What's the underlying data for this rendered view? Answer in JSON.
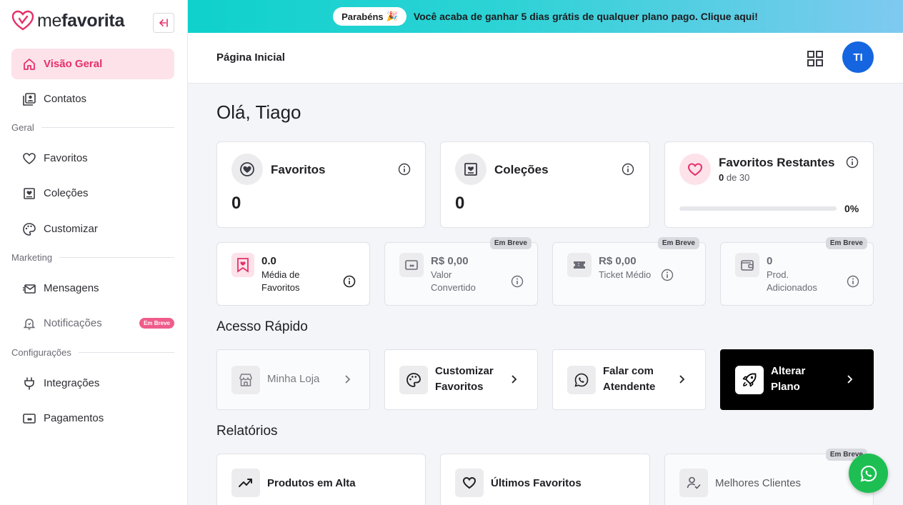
{
  "brand": {
    "name_light": "me",
    "name_bold": "favorita",
    "accent": "#e5306a"
  },
  "promo": {
    "pill": "Parabéns",
    "pill_emoji": "🎉",
    "text": "Você acaba de ganhar 5 dias grátis de qualquer plano pago. Clique aqui!"
  },
  "header": {
    "title": "Página Inicial",
    "avatar_initials": "TI"
  },
  "sidebar": {
    "items": [
      {
        "label": "Visão Geral",
        "icon": "home-icon"
      },
      {
        "label": "Contatos",
        "icon": "contacts-icon"
      },
      {
        "label": "Favoritos",
        "icon": "heart-icon"
      },
      {
        "label": "Coleções",
        "icon": "collection-icon"
      },
      {
        "label": "Customizar",
        "icon": "palette-icon"
      },
      {
        "label": "Mensagens",
        "icon": "mail-icon"
      },
      {
        "label": "Notificações",
        "icon": "bell-icon",
        "badge": "Em Breve"
      },
      {
        "label": "Integrações",
        "icon": "plug-icon"
      },
      {
        "label": "Pagamentos",
        "icon": "payment-icon"
      }
    ],
    "sections": [
      "Geral",
      "Marketing",
      "Configurações"
    ]
  },
  "main": {
    "greeting": "Olá, Tiago",
    "stats": [
      {
        "title": "Favoritos",
        "value": "0"
      },
      {
        "title": "Coleções",
        "value": "0"
      }
    ],
    "remaining": {
      "title": "Favoritos Restantes",
      "current": "0",
      "of_text": "de 30",
      "percent": "0%",
      "fraction": 0
    },
    "metrics": [
      {
        "value": "0.0",
        "label_line1": "Média de",
        "label_line2": "Favoritos"
      },
      {
        "value": "R$ 0,00",
        "label_line1": "Valor",
        "label_line2": "Convertido",
        "soon": "Em Breve"
      },
      {
        "value": "R$ 0,00",
        "label_line1": "Ticket Médio",
        "soon": "Em Breve"
      },
      {
        "value": "0",
        "label_line1": "Prod.",
        "label_line2": "Adicionados",
        "soon": "Em Breve"
      }
    ],
    "quick_title": "Acesso Rápido",
    "quick": [
      {
        "line1": "Minha Loja"
      },
      {
        "line1": "Customizar",
        "line2": "Favoritos"
      },
      {
        "line1": "Falar com",
        "line2": "Atendente"
      },
      {
        "line1": "Alterar",
        "line2": "Plano"
      }
    ],
    "reports_title": "Relatórios",
    "reports": [
      {
        "label": "Produtos em Alta"
      },
      {
        "label": "Últimos Favoritos"
      },
      {
        "label": "Melhores Clientes",
        "soon": "Em Breve"
      }
    ]
  }
}
